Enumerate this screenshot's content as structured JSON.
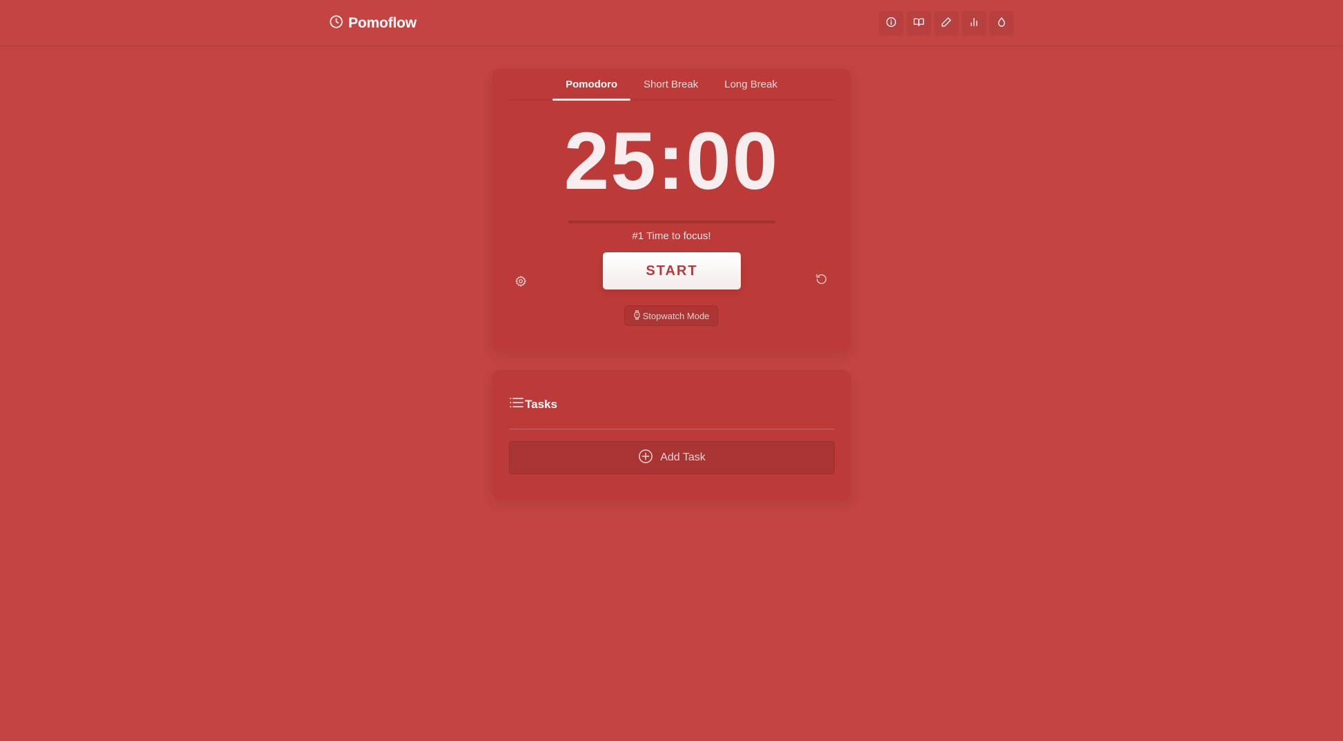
{
  "header": {
    "brand_name": "Pomoflow",
    "nav_icons": [
      "info-icon",
      "book-icon",
      "pencil-icon",
      "bar-chart-icon",
      "droplet-icon"
    ]
  },
  "timer": {
    "tabs": [
      {
        "label": "Pomodoro",
        "active": true
      },
      {
        "label": "Short Break",
        "active": false
      },
      {
        "label": "Long Break",
        "active": false
      }
    ],
    "time": "25:00",
    "progress": 0,
    "focus_label": "#1 Time to focus!",
    "start_label": "START",
    "stopwatch_label": "Stopwatch Mode"
  },
  "tasks": {
    "title": "Tasks",
    "add_label": "Add Task"
  },
  "colors": {
    "background": "#c44442",
    "accent_text": "#b53a38"
  }
}
